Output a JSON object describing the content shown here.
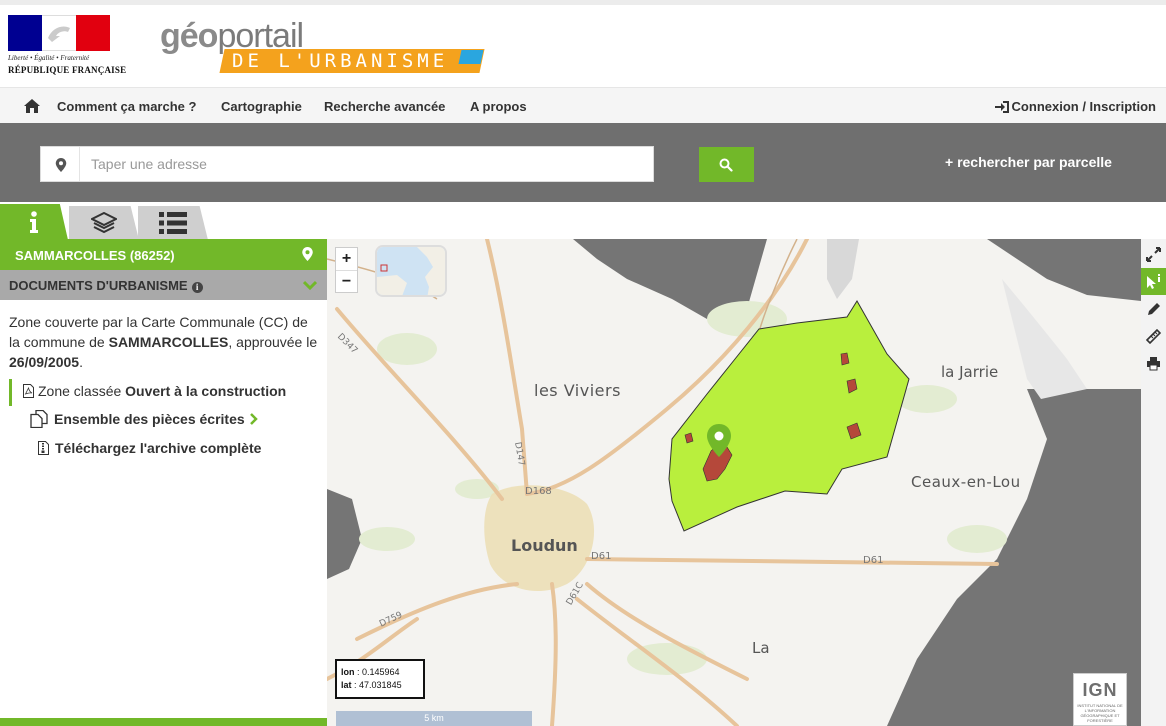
{
  "header": {
    "rf_motto": "Liberté • Égalité • Fraternité",
    "rf_name": "RÉPUBLIQUE FRANÇAISE",
    "brand_prefix": "géo",
    "brand_main": "portail",
    "brand_sub": "DE L'URBANISME"
  },
  "nav": {
    "home_icon": "home-icon",
    "items": [
      "Comment ça marche ?",
      "Cartographie",
      "Recherche avancée",
      "A propos"
    ],
    "login": "Connexion / Inscription"
  },
  "search": {
    "placeholder": "Taper une adresse",
    "parcel_link": "+ rechercher par parcelle"
  },
  "tabs": [
    {
      "icon": "info-icon",
      "active": true
    },
    {
      "icon": "layers-icon",
      "active": false
    },
    {
      "icon": "list-icon",
      "active": false
    }
  ],
  "panel": {
    "commune": "SAMMARCOLLES (86252)",
    "docs_title": "DOCUMENTS D'URBANISME",
    "desc_1": "Zone couverte par la Carte Communale (CC) de la commune de ",
    "desc_commune": "SAMMARCOLLES",
    "desc_2": ", approuvée le ",
    "desc_date": "26/09/2005",
    "desc_3": ".",
    "zone_prefix": "Zone classée ",
    "zone_value": "Ouvert à la construction",
    "pieces": "Ensemble des pièces écrites",
    "archive": "Téléchargez l'archive complète"
  },
  "map": {
    "zoom_in": "+",
    "zoom_out": "−",
    "coords": {
      "lon_label": "lon",
      "lon": "0.145964",
      "lat_label": "lat",
      "lat": "47.031845"
    },
    "scale": "5 km",
    "labels": {
      "viviers": "les Viviers",
      "jarrie": "la Jarrie",
      "ceaux": "Ceaux-en-Lou",
      "loudun": "Loudun",
      "la": "La"
    },
    "roads": {
      "d347": "D347",
      "d147": "D147",
      "d168": "D168",
      "d61": "D61",
      "d61_east": "D61",
      "d61c": "D61C",
      "d759": "D759"
    },
    "ign": {
      "mark": "IGN",
      "text": "INSTITUT NATIONAL DE L'INFORMATION GÉOGRAPHIQUE ET FORESTIÈRE"
    },
    "colors": {
      "zone": "#b9ef3d",
      "constructible": "#b5483a",
      "commune_grey": "#757575",
      "accent": "#72b829"
    }
  },
  "toolbar": [
    "fullscreen-icon",
    "info-cursor-icon",
    "pencil-icon",
    "ruler-icon",
    "print-icon"
  ]
}
